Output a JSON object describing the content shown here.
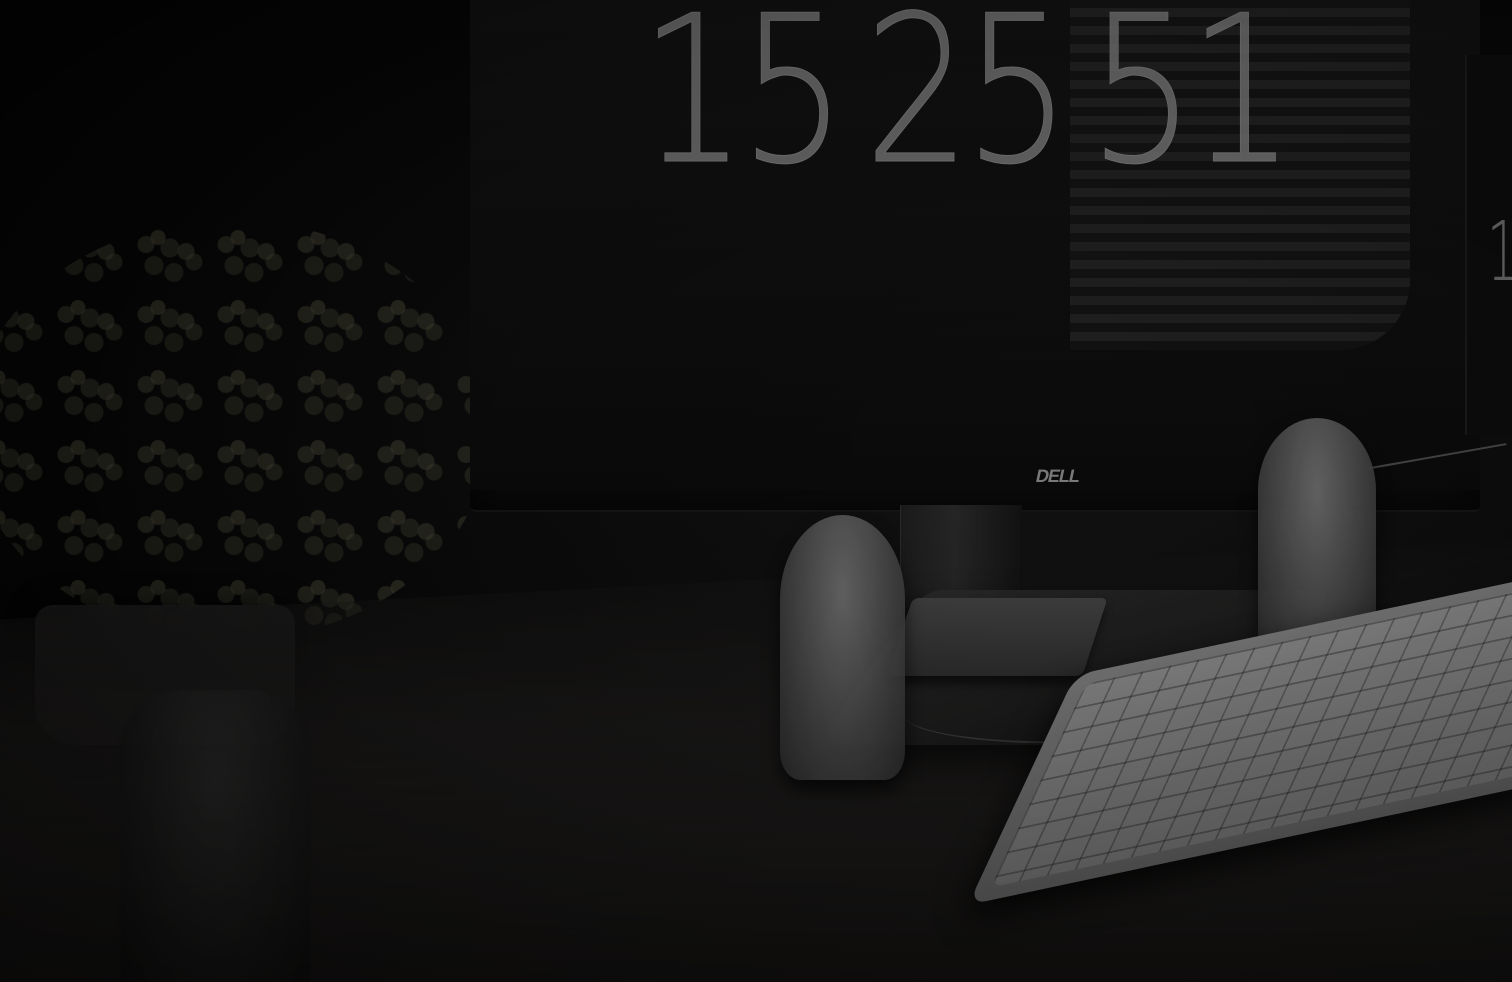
{
  "screen": {
    "clock": {
      "hours": "15",
      "minutes": "25",
      "seconds": "51"
    },
    "side_clock_digit": "1"
  },
  "monitor_brand": "DELL"
}
